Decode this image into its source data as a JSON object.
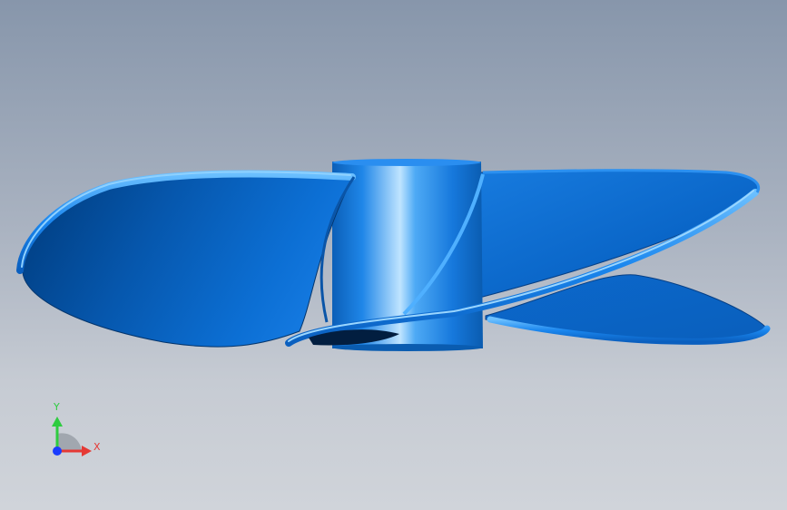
{
  "viewport": {
    "background_top": "#8796ab",
    "background_bottom": "#d0d4da"
  },
  "model": {
    "name_icon": "propeller-3d-model",
    "color": "#0a6fd1"
  },
  "triad": {
    "icon": "coordinate-triad-icon",
    "y_label": "Y",
    "x_label": "X",
    "y_color": "#2ecc40",
    "x_color": "#e53935",
    "z_color": "#1a3cff"
  }
}
